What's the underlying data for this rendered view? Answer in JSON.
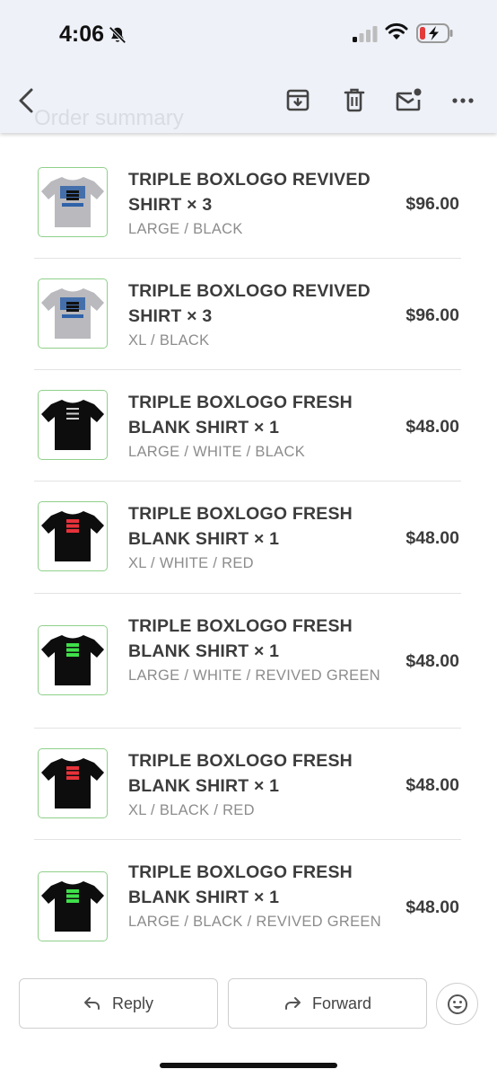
{
  "status_bar": {
    "time": "4:06"
  },
  "email": {
    "ghost_title": "Order summary"
  },
  "items": [
    {
      "title": "TRIPLE BOXLOGO REVIVED SHIRT × 3",
      "variant": "LARGE / BLACK",
      "price": "$96.00",
      "shirt": "grey",
      "print_text": "BASEBALL"
    },
    {
      "title": "TRIPLE BOXLOGO REVIVED SHIRT × 3",
      "variant": "XL / BLACK",
      "price": "$96.00",
      "shirt": "grey",
      "print_text": "BASEBALL"
    },
    {
      "title": "TRIPLE BOXLOGO FRESH BLANK SHIRT × 1",
      "variant": "LARGE / WHITE / BLACK",
      "price": "$48.00",
      "shirt": "black",
      "accent": "#ffffff"
    },
    {
      "title": "TRIPLE BOXLOGO FRESH BLANK SHIRT × 1",
      "variant": "XL / WHITE / RED",
      "price": "$48.00",
      "shirt": "black",
      "accent": "#e8323a"
    },
    {
      "title": "TRIPLE BOXLOGO FRESH BLANK SHIRT × 1",
      "variant": "LARGE / WHITE / REVIVED GREEN",
      "price": "$48.00",
      "shirt": "black",
      "accent": "#3fe04a"
    },
    {
      "title": "TRIPLE BOXLOGO FRESH BLANK SHIRT × 1",
      "variant": "XL / BLACK / RED",
      "price": "$48.00",
      "shirt": "black",
      "accent": "#e8323a"
    },
    {
      "title": "TRIPLE BOXLOGO FRESH BLANK SHIRT × 1",
      "variant": "LARGE / BLACK / REVIVED GREEN",
      "price": "$48.00",
      "shirt": "black",
      "accent": "#3fe04a"
    }
  ],
  "actions": {
    "reply": "Reply",
    "forward": "Forward"
  },
  "colors": {
    "header_bg": "#eef1f8",
    "text": "#3c3c3c",
    "muted": "#8c8c8c",
    "thumb_border": "#8fd08a",
    "battery_low": "#e23b3b"
  }
}
